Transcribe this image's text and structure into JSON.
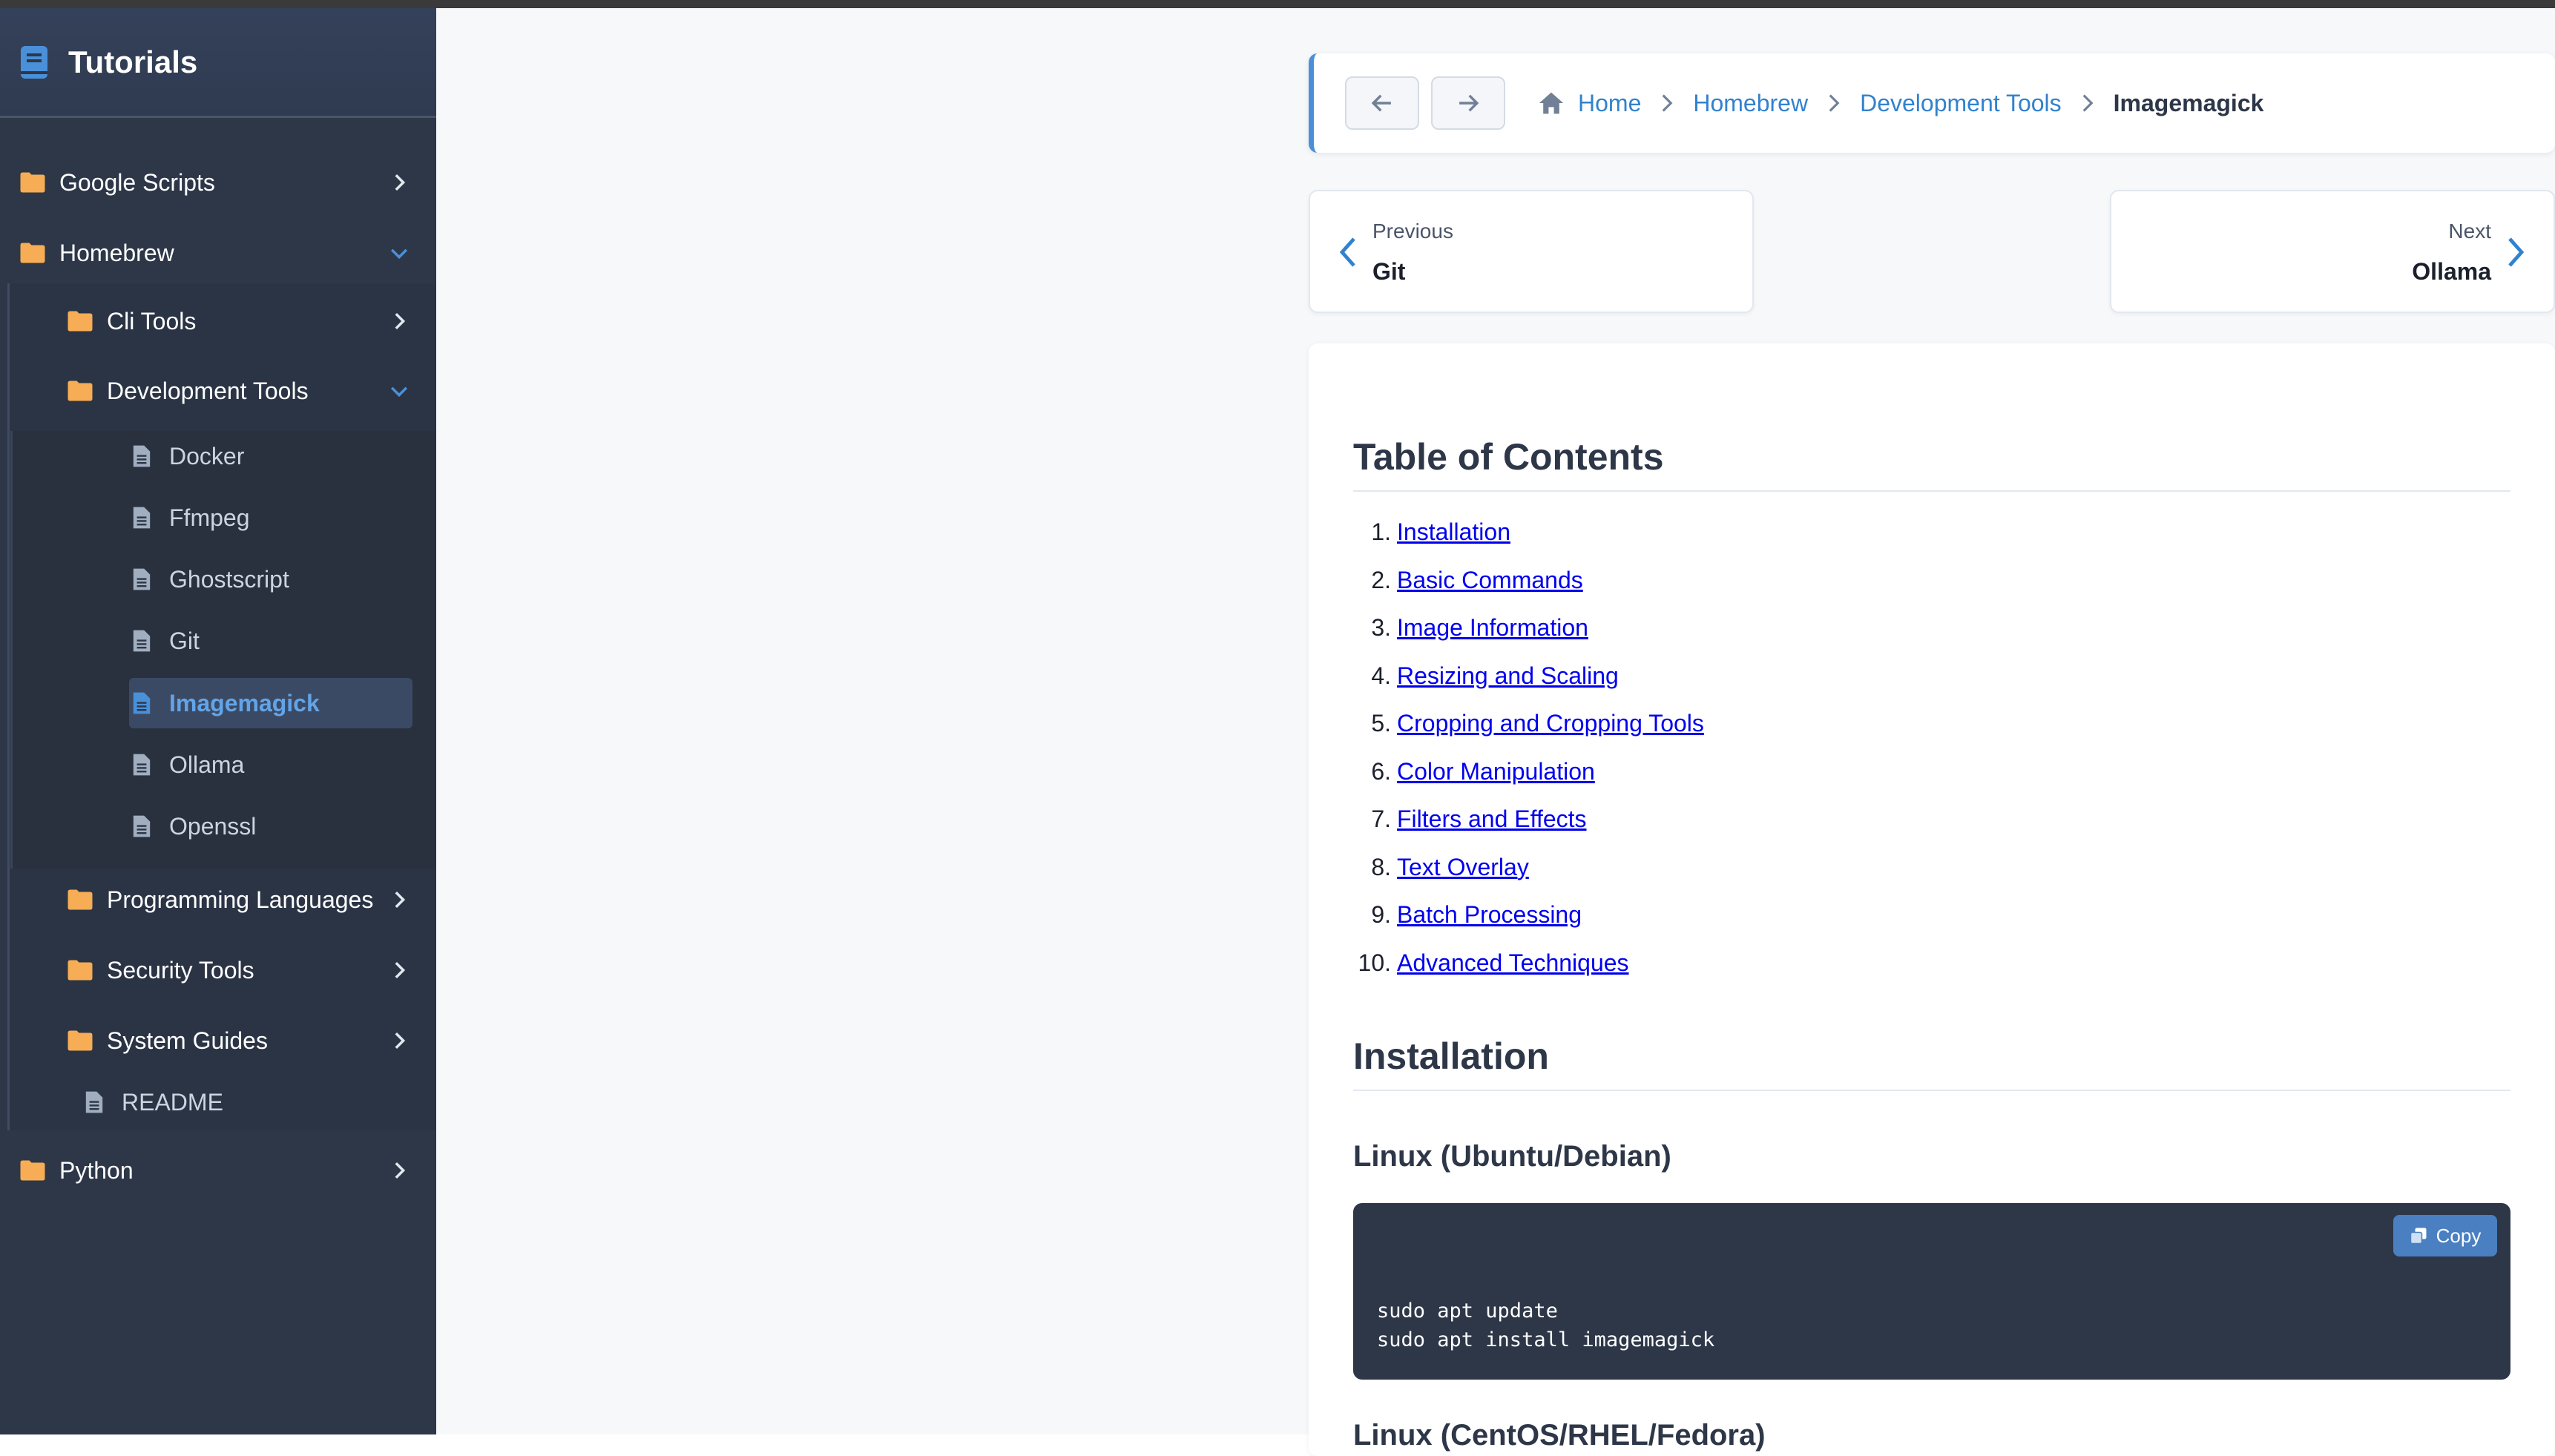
{
  "sidebar": {
    "title": "Tutorials",
    "folders": {
      "google_scripts": "Google Scripts",
      "homebrew": "Homebrew",
      "cli_tools": "Cli Tools",
      "development_tools": "Development Tools",
      "programming_languages": "Programming Languages",
      "security_tools": "Security Tools",
      "system_guides": "System Guides",
      "python": "Python"
    },
    "dev_files": [
      "Docker",
      "Ffmpeg",
      "Ghostscript",
      "Git",
      "Imagemagick",
      "Ollama",
      "Openssl"
    ],
    "readme": "README",
    "active_item": "Imagemagick"
  },
  "breadcrumb": {
    "items": [
      "Home",
      "Homebrew",
      "Development Tools"
    ],
    "current": "Imagemagick"
  },
  "pager": {
    "previous_label": "Previous",
    "previous_title": "Git",
    "next_label": "Next",
    "next_title": "Ollama"
  },
  "content": {
    "toc_heading": "Table of Contents",
    "toc": [
      "Installation",
      "Basic Commands",
      "Image Information",
      "Resizing and Scaling",
      "Cropping and Cropping Tools",
      "Color Manipulation",
      "Filters and Effects",
      "Text Overlay",
      "Batch Processing",
      "Advanced Techniques"
    ],
    "toc_numbers": [
      "1.",
      "2.",
      "3.",
      "4.",
      "5.",
      "6.",
      "7.",
      "8.",
      "9.",
      "10."
    ],
    "installation_heading": "Installation",
    "linux_debian_heading": "Linux (Ubuntu/Debian)",
    "code_block": "sudo apt update\nsudo apt install imagemagick",
    "copy_label": "Copy",
    "next_heading": "Linux (CentOS/RHEL/Fedora)"
  },
  "colors": {
    "sidebar_bg": "#2d3748",
    "folder_icon": "#f6ad55",
    "link": "#3182ce",
    "active": "#63a4e8"
  },
  "icons": {
    "logo": "book-icon",
    "folder": "folder-icon",
    "file": "file-icon",
    "home": "home-icon",
    "copy": "copy-icon"
  }
}
